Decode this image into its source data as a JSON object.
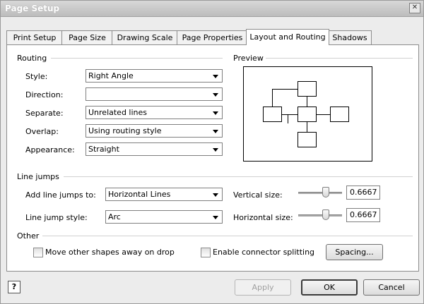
{
  "window": {
    "title": "Page Setup"
  },
  "tabs": [
    {
      "label": "Print Setup"
    },
    {
      "label": "Page Size"
    },
    {
      "label": "Drawing Scale"
    },
    {
      "label": "Page Properties"
    },
    {
      "label": "Layout and Routing",
      "active": true
    },
    {
      "label": "Shadows"
    }
  ],
  "routing": {
    "heading": "Routing",
    "style": {
      "label": "Style:",
      "value": "Right Angle"
    },
    "direction": {
      "label": "Direction:",
      "value": ""
    },
    "separate": {
      "label": "Separate:",
      "value": "Unrelated lines"
    },
    "overlap": {
      "label": "Overlap:",
      "value": "Using routing style"
    },
    "appearance": {
      "label": "Appearance:",
      "value": "Straight"
    }
  },
  "preview": {
    "heading": "Preview"
  },
  "line_jumps": {
    "heading": "Line jumps",
    "add": {
      "label": "Add line jumps to:",
      "value": "Horizontal Lines"
    },
    "style": {
      "label": "Line jump style:",
      "value": "Arc"
    },
    "vertical": {
      "label": "Vertical size:",
      "value": "0.6667"
    },
    "horizontal": {
      "label": "Horizontal size:",
      "value": "0.6667"
    }
  },
  "other": {
    "heading": "Other",
    "move_shapes": {
      "label": "Move other shapes away on drop",
      "checked": false
    },
    "connector_split": {
      "label": "Enable connector splitting",
      "checked": false
    },
    "spacing_label": "Spacing..."
  },
  "footer": {
    "apply_label": "Apply",
    "ok_label": "OK",
    "cancel_label": "Cancel"
  }
}
